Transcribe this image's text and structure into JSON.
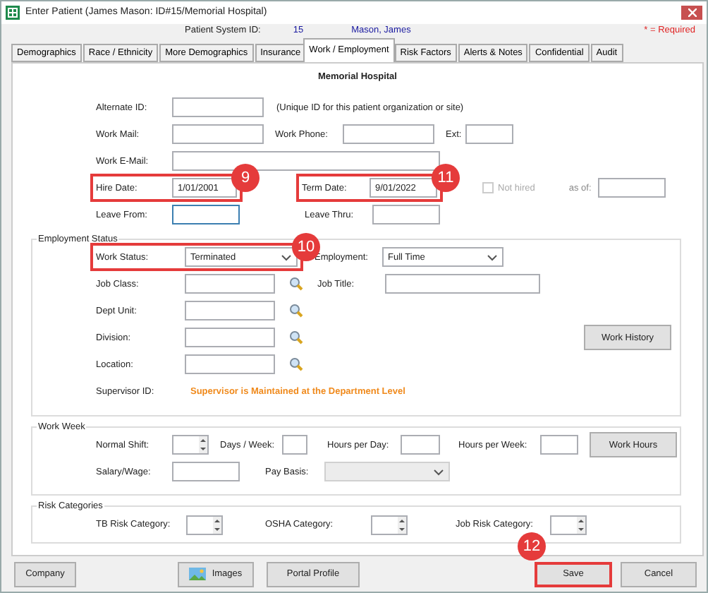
{
  "window": {
    "title": "Enter Patient (James Mason: ID#15/Memorial Hospital)"
  },
  "header": {
    "id_label": "Patient System ID:",
    "id": "15",
    "name": "Mason, James",
    "required_note": "* = Required"
  },
  "tabs": [
    {
      "label": "Demographics",
      "selected": false
    },
    {
      "label": "Race / Ethnicity",
      "selected": false
    },
    {
      "label": "More Demographics",
      "selected": false
    },
    {
      "label": "Insurance",
      "selected": false
    },
    {
      "label": "Work / Employment",
      "selected": true
    },
    {
      "label": "Risk Factors",
      "selected": false
    },
    {
      "label": "Alerts & Notes",
      "selected": false
    },
    {
      "label": "Confidential",
      "selected": false
    },
    {
      "label": "Audit",
      "selected": false
    }
  ],
  "organization": "Memorial Hospital",
  "identity": {
    "alternate_id": {
      "label": "Alternate ID:"
    },
    "alternate_id_hint": "(Unique ID for this patient organization or site)",
    "work_mail": {
      "label": "Work Mail:"
    },
    "work_phone": {
      "label": "Work Phone:"
    },
    "ext": {
      "label": "Ext:"
    },
    "work_email": {
      "label": "Work E-Mail:"
    },
    "hire_date": {
      "label": "Hire Date:",
      "value": "1/01/2001",
      "highlighted": true,
      "badge": "9"
    },
    "term_date": {
      "label": "Term Date:",
      "value": "9/01/2022",
      "highlighted": true,
      "badge": "11"
    },
    "not_hired": {
      "label": "Not hired",
      "checked": false,
      "disabled": true
    },
    "as_of": {
      "label": "as of:"
    },
    "leave_from": {
      "label": "Leave From:",
      "focused": true
    },
    "leave_thru": {
      "label": "Leave Thru:"
    }
  },
  "employment_status": {
    "title": "Employment Status",
    "work_status": {
      "label": "Work Status:",
      "value": "Terminated",
      "highlighted": true,
      "badge": "10"
    },
    "employment": {
      "label": "Employment:",
      "value": "Full Time"
    },
    "job_title": {
      "label": "Job Title:"
    },
    "lookups": [
      {
        "label": "Job Class:"
      },
      {
        "label": "Dept Unit:"
      },
      {
        "label": "Division:"
      },
      {
        "label": "Location:"
      }
    ],
    "work_history_button": "Work History",
    "supervisor": {
      "label": "Supervisor ID:",
      "note": "Supervisor is Maintained at the Department Level"
    }
  },
  "work_week": {
    "title": "Work Week",
    "normal_shift": {
      "label": "Normal Shift:"
    },
    "days_per_week": {
      "label": "Days / Week:"
    },
    "hours_per_day": {
      "label": "Hours per Day:"
    },
    "hours_per_week": {
      "label": "Hours per Week:"
    },
    "work_hours_button": "Work Hours",
    "salary_wage": {
      "label": "Salary/Wage:"
    },
    "pay_basis": {
      "label": "Pay Basis:",
      "disabled": true
    }
  },
  "risk_categories": {
    "title": "Risk Categories",
    "items": [
      {
        "label": "TB Risk Category:"
      },
      {
        "label": "OSHA Category:"
      },
      {
        "label": "Job Risk Category:"
      }
    ]
  },
  "footer_buttons": [
    {
      "label": "Company",
      "kind": "plain"
    },
    {
      "label": "Images",
      "kind": "image"
    },
    {
      "label": "Portal Profile",
      "kind": "plain"
    },
    {
      "label": "Save",
      "kind": "plain",
      "highlighted": true,
      "badge": "12"
    },
    {
      "label": "Cancel",
      "kind": "plain"
    }
  ]
}
